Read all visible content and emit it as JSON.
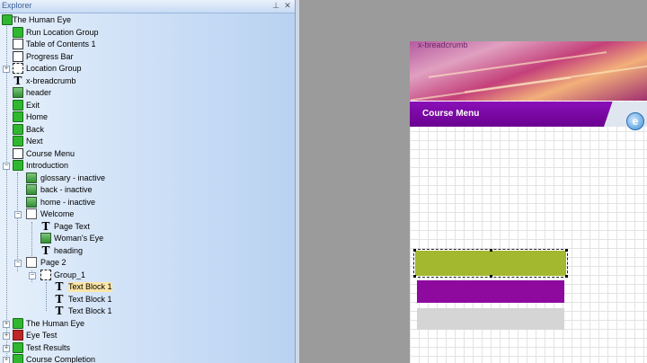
{
  "explorer": {
    "title": "Explorer",
    "pin_icon": "pin-icon",
    "close_icon": "close-icon"
  },
  "tree": [
    {
      "label": "The Human Eye",
      "icon": "chapter-icon"
    },
    {
      "label": "Run Location Group",
      "icon": "location-icon"
    },
    {
      "label": "Table of Contents 1",
      "icon": "toc-icon"
    },
    {
      "label": "Progress Bar",
      "icon": "progress-bar-icon"
    },
    {
      "label": "Location Group",
      "icon": "group-icon"
    },
    {
      "label": "x-breadcrumb",
      "icon": "text-icon"
    },
    {
      "label": "header",
      "icon": "image-icon"
    },
    {
      "label": "Exit",
      "icon": "button-icon"
    },
    {
      "label": "Home",
      "icon": "button-icon"
    },
    {
      "label": "Back",
      "icon": "button-icon"
    },
    {
      "label": "Next",
      "icon": "button-icon"
    },
    {
      "label": "Course Menu",
      "icon": "menu-icon"
    },
    {
      "label": "Introduction",
      "icon": "chapter-icon"
    },
    {
      "label": "glossary - inactive",
      "icon": "image-icon"
    },
    {
      "label": "back - inactive",
      "icon": "image-icon"
    },
    {
      "label": "home - inactive",
      "icon": "image-icon"
    },
    {
      "label": "Welcome",
      "icon": "page-icon"
    },
    {
      "label": "Page Text",
      "icon": "text-icon"
    },
    {
      "label": "Woman's Eye",
      "icon": "image-icon"
    },
    {
      "label": "heading",
      "icon": "text-icon"
    },
    {
      "label": "Page 2",
      "icon": "page-icon"
    },
    {
      "label": "Group_1",
      "icon": "group-icon"
    },
    {
      "label": "Text Block 1",
      "icon": "text-icon"
    },
    {
      "label": "Text Block 1",
      "icon": "text-icon"
    },
    {
      "label": "Text Block 1",
      "icon": "text-icon"
    },
    {
      "label": "The Human Eye",
      "icon": "chapter-icon"
    },
    {
      "label": "Eye Test",
      "icon": "test-icon"
    },
    {
      "label": "Test Results",
      "icon": "chapter-icon"
    },
    {
      "label": "Course Completion",
      "icon": "chapter-icon"
    }
  ],
  "canvas": {
    "breadcrumb": "x-breadcrumb",
    "course_menu": "Course Menu",
    "colors": {
      "menu_bar": "#7a05a8",
      "block_green": "#a3b82f",
      "block_purple": "#8e0a9e",
      "block_gray": "#d5d5d5"
    }
  }
}
